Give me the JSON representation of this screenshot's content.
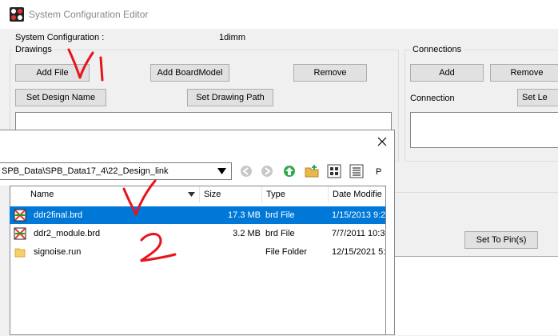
{
  "window": {
    "title": "System Configuration Editor",
    "icon": "app-logo-icon"
  },
  "system_config": {
    "label": "System Configuration :",
    "value": "1dimm"
  },
  "drawings": {
    "group_label": "Drawings",
    "add_file": "Add File",
    "add_board_model": "Add BoardModel",
    "remove": "Remove",
    "set_design_name": "Set Design Name",
    "set_drawing_path": "Set Drawing Path"
  },
  "connections": {
    "group_label": "Connections",
    "add": "Add",
    "remove": "Remove",
    "connection_label": "Connection",
    "set_le": "Set Le"
  },
  "set_to_pins": "Set To Pin(s)",
  "file_dialog": {
    "path": "SPB_Data\\SPB_Data17_4\\22_Design_link",
    "view_menu_letter": "P",
    "columns": [
      "Name",
      "Size",
      "Type",
      "Date Modifie"
    ],
    "files": [
      {
        "name": "ddr2final.brd",
        "size": "17.3 MB",
        "type": "brd File",
        "date": "1/15/2013 9:2",
        "icon": "brd-file-icon",
        "selected": true
      },
      {
        "name": "ddr2_module.brd",
        "size": "3.2 MB",
        "type": "brd File",
        "date": "7/7/2011 10:3",
        "icon": "brd-file-icon",
        "selected": false
      },
      {
        "name": "signoise.run",
        "size": "",
        "type": "File Folder",
        "date": "12/15/2021 5:",
        "icon": "folder-icon",
        "selected": false
      }
    ]
  },
  "colors": {
    "selection": "#0078d7",
    "annotation": "#e8141c"
  }
}
